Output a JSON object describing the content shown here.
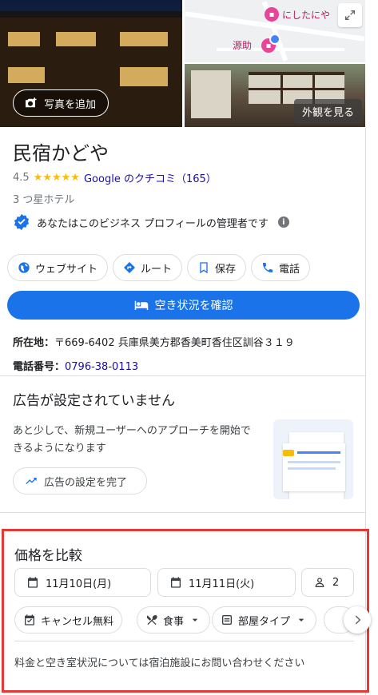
{
  "photos": {
    "add_photo_label": "写真を追加",
    "exterior_label": "外観を見る",
    "map_labels": [
      "にしたにや",
      "源助"
    ]
  },
  "business": {
    "name": "民宿かどや",
    "rating": "4.5",
    "stars": "★★★★★",
    "review_link": "Google のクチコミ（165）",
    "category": "3 つ星ホテル",
    "owner_notice": "あなたはこのビジネス プロフィールの管理者です"
  },
  "actions": {
    "website": "ウェブサイト",
    "route": "ルート",
    "save": "保存",
    "call": "電話",
    "check_availability": "空き状況を確認"
  },
  "details": {
    "address_label": "所在地：",
    "address_value": "〒669-6402 兵庫県美方郡香美町香住区訓谷３１９",
    "phone_label": "電話番号：",
    "phone_value": "0796-38-0113"
  },
  "ads": {
    "title": "広告が設定されていません",
    "description": "あと少しで、新規ユーザーへのアプローチを開始できるようになります",
    "button": "広告の設定を完了"
  },
  "price_compare": {
    "title": "価格を比較",
    "checkin": "11月10日(月)",
    "checkout": "11月11日(火)",
    "guests": "2",
    "filters": [
      "キャンセル無料",
      "食事",
      "部屋タイプ"
    ],
    "note": "料金と空き室状況については宿泊施設にお問い合わせください"
  },
  "colors": {
    "accent": "#1a73e8",
    "link": "#1a0dab",
    "star": "#fbbc04",
    "highlight_border": "#e53935"
  }
}
